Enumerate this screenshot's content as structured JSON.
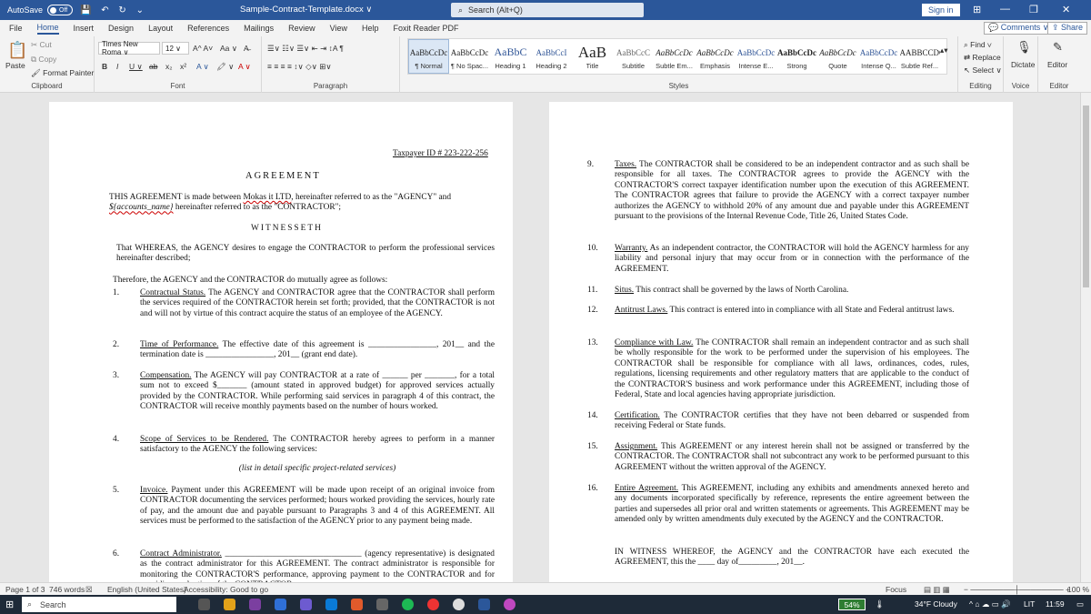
{
  "titlebar": {
    "autosave_label": "AutoSave",
    "autosave_state": "Off",
    "quick_access": "💾 ↶ ↻ ⌄",
    "doc_title": "Sample-Contract-Template.docx ∨",
    "search_placeholder": "Search (Alt+Q)",
    "sign_in": "Sign in",
    "window_controls": [
      "⊞",
      "—",
      "❐",
      "✕"
    ]
  },
  "tabs": [
    "File",
    "Home",
    "Insert",
    "Design",
    "Layout",
    "References",
    "Mailings",
    "Review",
    "View",
    "Help",
    "Foxit Reader PDF"
  ],
  "active_tab": "Home",
  "tab_right": {
    "comments": "💬 Comments ∨",
    "share": "⇪ Share"
  },
  "ribbon": {
    "clipboard": {
      "paste": "Paste",
      "cut": "✂ Cut",
      "copy": "⧉ Copy",
      "format_painter": "🖌 Format Painter",
      "label": "Clipboard"
    },
    "font": {
      "name": "Times New Roma ∨",
      "size": "12 ∨",
      "grow": "A^ A˅",
      "case": "Aa ∨",
      "clear": "A̶",
      "bold": "B",
      "italic": "I",
      "underline": "U ∨",
      "strike": "ab",
      "sub": "x₂",
      "sup": "x²",
      "effects": "A ∨",
      "highlight": "🖍 ∨",
      "color": "A ∨",
      "label": "Font"
    },
    "paragraph": {
      "row1": "☰∨ ☷∨ ☰∨ ⇤ ⇥ ↕A ¶",
      "row2": "≡ ≡ ≡ ≡ ↕∨ ◇∨ ⊞∨",
      "label": "Paragraph"
    },
    "styles": {
      "items": [
        {
          "preview": "AaBbCcDc",
          "name": "¶ Normal"
        },
        {
          "preview": "AaBbCcDc",
          "name": "¶ No Spac..."
        },
        {
          "preview": "AaBbC",
          "name": "Heading 1"
        },
        {
          "preview": "AaBbCcI",
          "name": "Heading 2"
        },
        {
          "preview": "AaB",
          "name": "Title"
        },
        {
          "preview": "AaBbCcC",
          "name": "Subtitle"
        },
        {
          "preview": "AaBbCcDc",
          "name": "Subtle Em..."
        },
        {
          "preview": "AaBbCcDc",
          "name": "Emphasis"
        },
        {
          "preview": "AaBbCcDc",
          "name": "Intense E..."
        },
        {
          "preview": "AaBbCcDc",
          "name": "Strong"
        },
        {
          "preview": "AaBbCcDc",
          "name": "Quote"
        },
        {
          "preview": "AaBbCcDc",
          "name": "Intense Q..."
        },
        {
          "preview": "AABBCCDC",
          "name": "Subtle Ref..."
        }
      ],
      "label": "Styles"
    },
    "editing": {
      "find": "⌕ Find ∨",
      "replace": "⇄ Replace",
      "select": "↖ Select ∨",
      "label": "Editing"
    },
    "voice": {
      "dictate": "Dictate",
      "label": "Voice"
    },
    "editor": {
      "editor": "Editor",
      "label": "Editor"
    }
  },
  "doc": {
    "p1": {
      "taxpayer": "Taxpayer ID # 223-222-256",
      "heading": "AGREEMENT",
      "intro_a": "THIS AGREEMENT is made between ",
      "intro_company": "Mokas it LTD",
      "intro_b": ", hereinafter referred to as the \"AGENCY\" and",
      "intro_var": "${accounts_name}",
      "intro_c": " hereinafter referred to as the \"CONTRACTOR\";",
      "witnesseth": "WITNESSETH",
      "whereas": "That WHEREAS, the AGENCY desires to engage the CONTRACTOR to perform the professional services hereinafter described;",
      "therefore": "Therefore, the AGENCY and the CONTRACTOR do mutually agree as follows:",
      "clauses": [
        {
          "num": "1.",
          "title": "Contractual Status.",
          "text": "  The AGENCY and CONTRACTOR agree that the CONTRACTOR shall perform the services required of the CONTRACTOR herein set forth; provided, that the CONTRACTOR is not and will not by virtue of this contract acquire the status of an employee of the AGENCY."
        },
        {
          "num": "2.",
          "title": "Time of Performance.",
          "text": "   The effective date of this agreement is ________________, 201__ and the termination date is ________________, 201__ (grant end date)."
        },
        {
          "num": "3.",
          "title": "Compensation.",
          "text": "  The AGENCY will pay CONTRACTOR at a rate of ______ per _______, for a total sum not to exceed $_______ (amount stated in approved budget) for approved services actually provided by the CONTRACTOR.  While performing said services in paragraph 4 of this contract, the CONTRACTOR will receive monthly payments based on the number of hours worked."
        },
        {
          "num": "4.",
          "title": "Scope of Services to be Rendered.",
          "text": "   The CONTRACTOR hereby agrees to perform in a manner satisfactory to the AGENCY the following services:"
        },
        {
          "num": "5.",
          "title": "Invoice.",
          "text": "   Payment under this AGREEMENT will be made upon receipt of an original invoice from CONTRACTOR documenting the services performed; hours worked providing the services, hourly rate of pay, and the amount due and payable pursuant to Paragraphs 3 and 4 of this AGREEMENT. All services must be performed to the satisfaction of the AGENCY prior to any payment being made."
        },
        {
          "num": "6.",
          "title": "Contract Administrator.",
          "text": "   ________________________________ (agency representative) is designated as the contract administrator for this AGREEMENT. The contract administrator is responsible for monitoring the CONTRACTOR'S performance, approving payment to the CONTRACTOR and for providing evaluation of the CONTRACTOR."
        }
      ],
      "scope_note": "(list in detail specific project-related services)"
    },
    "p2": {
      "clauses": [
        {
          "num": "9.",
          "title": "Taxes.",
          "text": " The CONTRACTOR shall be considered to be an independent contractor and as such shall be responsible for all taxes. The CONTRACTOR agrees to provide the AGENCY with the CONTRACTOR'S correct taxpayer identification number upon the execution of this AGREEMENT. The CONTRACTOR agrees that failure to provide the AGENCY with a correct taxpayer number authorizes the AGENCY to withhold 20% of any amount due and payable under this AGREEMENT pursuant to the provisions of the Internal Revenue Code, Title 26, United States Code."
        },
        {
          "num": "10.",
          "title": "Warranty.",
          "text": "    As an independent contractor, the CONTRACTOR will hold the AGENCY harmless for any liability and personal injury that may occur from or in connection with the performance of the AGREEMENT."
        },
        {
          "num": "11.",
          "title": "Situs.",
          "text": "  This contract shall be governed by the laws of North Carolina."
        },
        {
          "num": "12.",
          "title": "Antitrust Laws.",
          "text": "   This contract is entered into in compliance with all State and Federal antitrust laws."
        },
        {
          "num": "13.",
          "title": "Compliance with Law.",
          "text": "  The CONTRACTOR shall remain an independent contractor and as such shall be wholly responsible for the work to be performed under the supervision of his employees. The CONTRACTOR shall be responsible for compliance with all laws, ordinances, codes, rules, regulations, licensing requirements and other regulatory matters that are applicable to the conduct of the CONTRACTOR'S business and work performance under this AGREEMENT, including those of Federal, State and local agencies having appropriate jurisdiction."
        },
        {
          "num": "14.",
          "title": "Certification.",
          "text": "   The CONTRACTOR certifies that they have not been debarred or suspended from receiving Federal or State funds."
        },
        {
          "num": "15.",
          "title": "Assignment.",
          "text": "   This AGREEMENT or any interest herein shall not be assigned or transferred by the CONTRACTOR. The CONTRACTOR shall not subcontract any work to be performed pursuant to this AGREEMENT without the written approval of the AGENCY."
        },
        {
          "num": "16.",
          "title": "Entire Agreement.",
          "text": "   This AGREEMENT, including any exhibits and amendments annexed hereto and any documents incorporated specifically by reference, represents the entire agreement between the parties and supersedes all prior oral and written statements or agreements. This AGREEMENT may be amended only by written amendments duly executed by the AGENCY and the CONTRACTOR."
        }
      ],
      "witness": "IN WITNESS WHEREOF, the AGENCY and the CONTRACTOR have each executed the AGREEMENT, this the ____ day of_________, 201__."
    }
  },
  "status": {
    "page": "Page 1 of 3",
    "words": "746 words",
    "lang": "English (United States)",
    "accessibility": "Accessibility: Good to go",
    "focus": "Focus",
    "zoom": "100 %"
  },
  "taskbar": {
    "search": "Search",
    "cpu": "54%",
    "weather": "34°F  Cloudy",
    "lang": "LIT",
    "time": "11:59"
  },
  "colors": {
    "accent": "#2b579a",
    "taskbar": "#1e2a38"
  }
}
